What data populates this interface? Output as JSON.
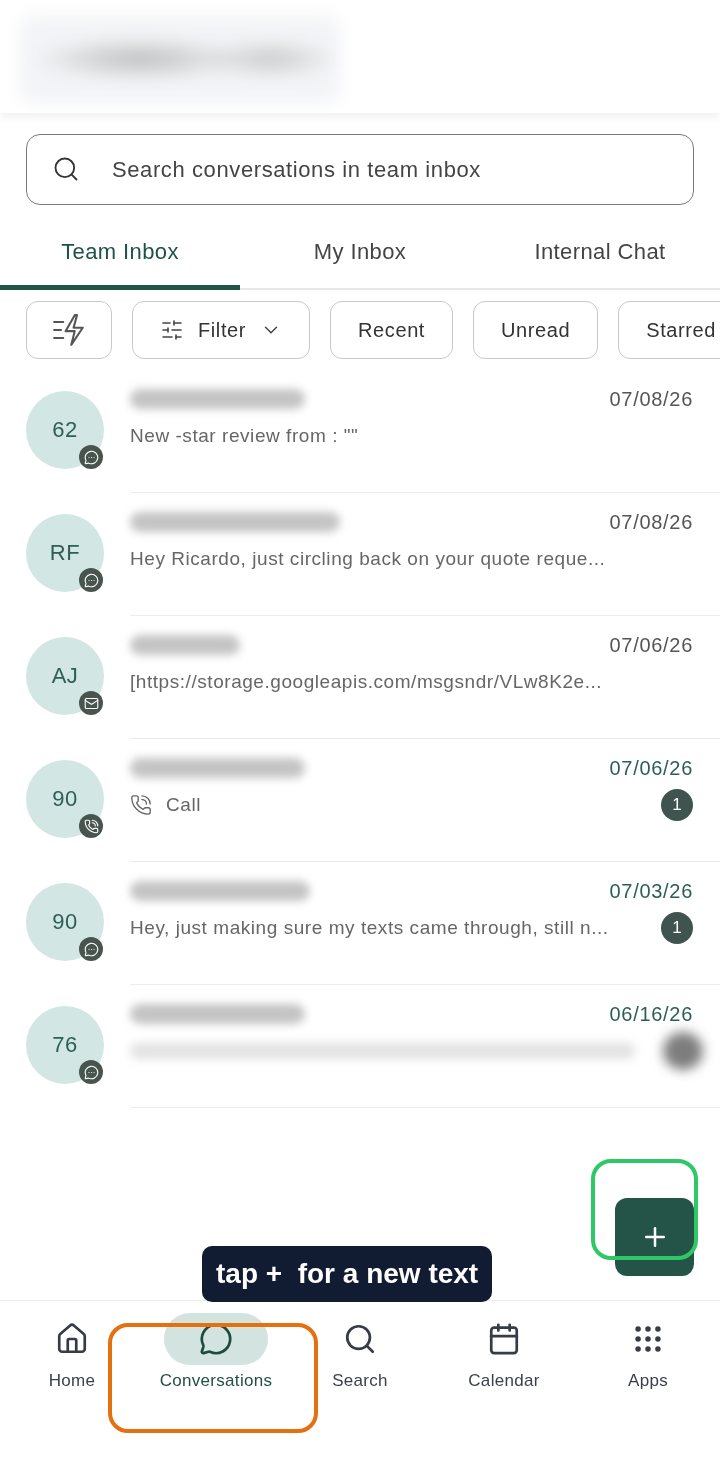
{
  "search": {
    "placeholder": "Search conversations in team inbox"
  },
  "tabs": [
    {
      "label": "Team Inbox",
      "selected": true
    },
    {
      "label": "My Inbox",
      "selected": false
    },
    {
      "label": "Internal Chat",
      "selected": false
    }
  ],
  "chips": [
    {
      "kind": "icon",
      "selected": false
    },
    {
      "kind": "dropdown",
      "label": "Filter",
      "selected": false
    },
    {
      "kind": "toggle",
      "label": "Recent",
      "selected": false
    },
    {
      "kind": "toggle",
      "label": "Unread",
      "selected": false
    },
    {
      "kind": "toggle",
      "label": "Starred",
      "selected": false
    }
  ],
  "conversations": [
    {
      "kind": "sms",
      "initials": "62",
      "date": "07/08/26",
      "unread": false,
      "preview": {
        "kind": "text",
        "text": "New -star review from : \"\""
      }
    },
    {
      "kind": "sms",
      "initials": "RF",
      "date": "07/08/26",
      "unread": false,
      "preview": {
        "kind": "text",
        "text": "Hey Ricardo, just circling back on your quote reque..."
      }
    },
    {
      "kind": "email",
      "initials": "AJ",
      "date": "07/06/26",
      "unread": false,
      "preview": {
        "kind": "text",
        "text": "[https://storage.googleapis.com/msgsndr/VLw8K2e..."
      }
    },
    {
      "kind": "call",
      "initials": "90",
      "date": "07/06/26",
      "unread": true,
      "badge": "1",
      "preview": {
        "kind": "call",
        "text": "Call"
      }
    },
    {
      "kind": "sms",
      "initials": "90",
      "date": "07/03/26",
      "unread": true,
      "badge": "1",
      "preview": {
        "kind": "text",
        "text": "Hey, just making sure my texts came through, still n..."
      }
    },
    {
      "kind": "sms",
      "initials": "76",
      "date": "06/16/26",
      "unread": true,
      "preview": {
        "kind": "redacted"
      }
    }
  ],
  "tooltip": "tap +  for a new text",
  "highlights": [
    {
      "kind": "button",
      "color": "#2ec866"
    },
    {
      "kind": "nav",
      "color": "#e4700e"
    }
  ],
  "nav": [
    {
      "label": "Home",
      "selected": false
    },
    {
      "label": "Conversations",
      "selected": true
    },
    {
      "label": "Search",
      "selected": false
    },
    {
      "label": "Calendar",
      "selected": false
    },
    {
      "label": "Apps",
      "selected": false
    }
  ]
}
